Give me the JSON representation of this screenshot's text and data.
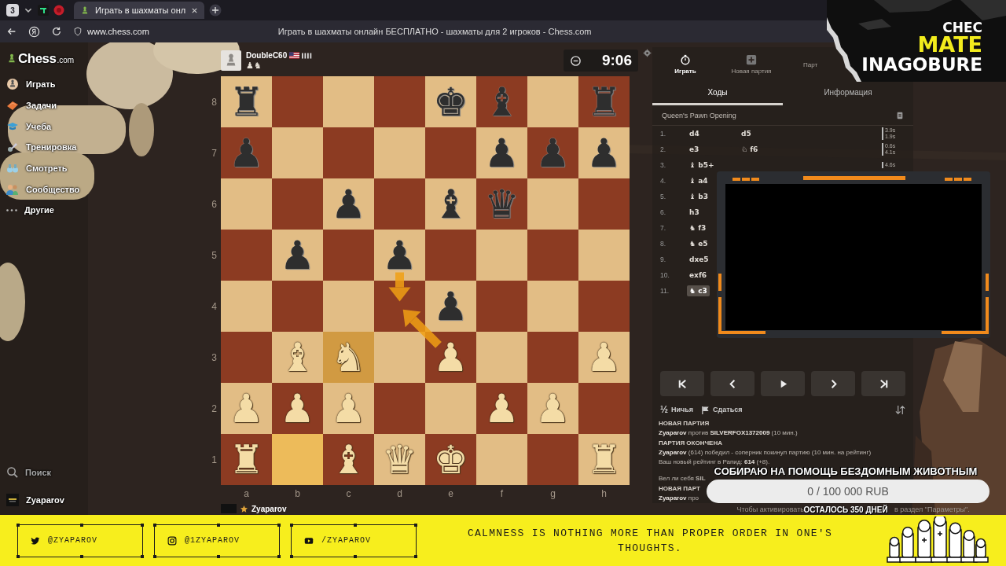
{
  "browser": {
    "tab_count": "3",
    "tabs": [
      {
        "title": "Играть в шахматы онл",
        "selected": true
      }
    ],
    "address": "www.chess.com",
    "page_title": "Играть в шахматы онлайн БЕСПЛАТНО - шахматы для 2 игроков - Chess.com"
  },
  "sidebar": {
    "logo": {
      "name": "Chess",
      "suffix": ".com"
    },
    "items": [
      {
        "kind": "play",
        "label": "Играть"
      },
      {
        "kind": "puzzles",
        "label": "Задачи"
      },
      {
        "kind": "learn",
        "label": "Учеба"
      },
      {
        "kind": "train",
        "label": "Тренировка"
      },
      {
        "kind": "watch",
        "label": "Смотреть"
      },
      {
        "kind": "community",
        "label": "Сообщество"
      },
      {
        "kind": "more",
        "label": "Другие"
      }
    ],
    "search": "Поиск",
    "user": "Zyaparov"
  },
  "board": {
    "top_player": {
      "name": "DoubleC60",
      "captured": "♟♞"
    },
    "clock": "9:06",
    "rank_labels": [
      "8",
      "7",
      "6",
      "5",
      "4",
      "3",
      "2",
      "1"
    ],
    "file_labels": [
      "a",
      "b",
      "c",
      "d",
      "e",
      "f",
      "g",
      "h"
    ],
    "ranks": [
      {
        "squares": [
          {
            "piece": "♜",
            "kind": "black",
            "highlighted": false,
            "arrow_start": false,
            "arrow_end": false
          },
          {
            "highlighted": false,
            "arrow_start": false,
            "arrow_end": false
          },
          {
            "highlighted": false,
            "arrow_start": false,
            "arrow_end": false
          },
          {
            "highlighted": false,
            "arrow_start": false,
            "arrow_end": false
          },
          {
            "piece": "♚",
            "kind": "black",
            "highlighted": false,
            "arrow_start": false,
            "arrow_end": false
          },
          {
            "piece": "♝",
            "kind": "black",
            "highlighted": false,
            "arrow_start": false,
            "arrow_end": false
          },
          {
            "highlighted": false,
            "arrow_start": false,
            "arrow_end": false
          },
          {
            "piece": "♜",
            "kind": "black",
            "highlighted": false,
            "arrow_start": false,
            "arrow_end": false
          }
        ]
      },
      {
        "squares": [
          {
            "piece": "♟",
            "kind": "black",
            "highlighted": false,
            "arrow_start": false,
            "arrow_end": false
          },
          {
            "highlighted": false,
            "arrow_start": false,
            "arrow_end": false
          },
          {
            "highlighted": false,
            "arrow_start": false,
            "arrow_end": false
          },
          {
            "highlighted": false,
            "arrow_start": false,
            "arrow_end": false
          },
          {
            "highlighted": false,
            "arrow_start": false,
            "arrow_end": false
          },
          {
            "piece": "♟",
            "kind": "black",
            "highlighted": false,
            "arrow_start": false,
            "arrow_end": false
          },
          {
            "piece": "♟",
            "kind": "black",
            "highlighted": false,
            "arrow_start": false,
            "arrow_end": false
          },
          {
            "piece": "♟",
            "kind": "black",
            "highlighted": false,
            "arrow_start": false,
            "arrow_end": false
          }
        ]
      },
      {
        "squares": [
          {
            "highlighted": false,
            "arrow_start": false,
            "arrow_end": false
          },
          {
            "highlighted": false,
            "arrow_start": false,
            "arrow_end": false
          },
          {
            "piece": "♟",
            "kind": "black",
            "highlighted": false,
            "arrow_start": false,
            "arrow_end": false
          },
          {
            "highlighted": false,
            "arrow_start": false,
            "arrow_end": false
          },
          {
            "piece": "♝",
            "kind": "black",
            "highlighted": false,
            "arrow_start": false,
            "arrow_end": false
          },
          {
            "piece": "♛",
            "kind": "black",
            "highlighted": false,
            "arrow_start": false,
            "arrow_end": false
          },
          {
            "highlighted": false,
            "arrow_start": false,
            "arrow_end": false
          },
          {
            "highlighted": false,
            "arrow_start": false,
            "arrow_end": false
          }
        ]
      },
      {
        "squares": [
          {
            "highlighted": false,
            "arrow_start": false,
            "arrow_end": false
          },
          {
            "piece": "♟",
            "kind": "black",
            "highlighted": false,
            "arrow_start": false,
            "arrow_end": false
          },
          {
            "highlighted": false,
            "arrow_start": false,
            "arrow_end": false
          },
          {
            "piece": "♟",
            "kind": "black",
            "highlighted": false,
            "arrow_start": true,
            "arrow_end": false
          },
          {
            "highlighted": false,
            "arrow_start": false,
            "arrow_end": false
          },
          {
            "highlighted": false,
            "arrow_start": false,
            "arrow_end": false
          },
          {
            "highlighted": false,
            "arrow_start": false,
            "arrow_end": false
          },
          {
            "highlighted": false,
            "arrow_start": false,
            "arrow_end": false
          }
        ]
      },
      {
        "squares": [
          {
            "highlighted": false,
            "arrow_start": false,
            "arrow_end": false
          },
          {
            "highlighted": false,
            "arrow_start": false,
            "arrow_end": false
          },
          {
            "highlighted": false,
            "arrow_start": false,
            "arrow_end": false
          },
          {
            "highlighted": false,
            "arrow_start": false,
            "arrow_end": true
          },
          {
            "piece": "♟",
            "kind": "black",
            "highlighted": false,
            "arrow_start": false,
            "arrow_end": false
          },
          {
            "highlighted": false,
            "arrow_start": false,
            "arrow_end": false
          },
          {
            "highlighted": false,
            "arrow_start": false,
            "arrow_end": false
          },
          {
            "highlighted": false,
            "arrow_start": false,
            "arrow_end": false
          }
        ]
      },
      {
        "squares": [
          {
            "highlighted": false,
            "arrow_start": false,
            "arrow_end": false
          },
          {
            "piece": "♝",
            "kind": "white",
            "highlighted": false,
            "arrow_start": false,
            "arrow_end": false
          },
          {
            "piece": "♞",
            "kind": "white",
            "highlighted": true,
            "arrow_start": false,
            "arrow_end": false
          },
          {
            "highlighted": false,
            "arrow_start": false,
            "arrow_end": false
          },
          {
            "piece": "♟",
            "kind": "white",
            "highlighted": false,
            "arrow_start": true,
            "arrow_end": false
          },
          {
            "highlighted": false,
            "arrow_start": false,
            "arrow_end": false
          },
          {
            "highlighted": false,
            "arrow_start": false,
            "arrow_end": false
          },
          {
            "piece": "♟",
            "kind": "white",
            "highlighted": false,
            "arrow_start": false,
            "arrow_end": false
          }
        ]
      },
      {
        "squares": [
          {
            "piece": "♟",
            "kind": "white",
            "highlighted": false,
            "arrow_start": false,
            "arrow_end": false
          },
          {
            "piece": "♟",
            "kind": "white",
            "highlighted": false,
            "arrow_start": false,
            "arrow_end": false
          },
          {
            "piece": "♟",
            "kind": "white",
            "highlighted": false,
            "arrow_start": false,
            "arrow_end": false
          },
          {
            "highlighted": false,
            "arrow_start": false,
            "arrow_end": false
          },
          {
            "highlighted": false,
            "arrow_start": false,
            "arrow_end": false
          },
          {
            "piece": "♟",
            "kind": "white",
            "highlighted": false,
            "arrow_start": false,
            "arrow_end": false
          },
          {
            "piece": "♟",
            "kind": "white",
            "highlighted": false,
            "arrow_start": false,
            "arrow_end": false
          },
          {
            "highlighted": false,
            "arrow_start": false,
            "arrow_end": false
          }
        ]
      },
      {
        "squares": [
          {
            "piece": "♜",
            "kind": "white",
            "highlighted": false,
            "arrow_start": false,
            "arrow_end": false
          },
          {
            "highlighted": true,
            "arrow_start": false,
            "arrow_end": false
          },
          {
            "piece": "♝",
            "kind": "white",
            "highlighted": false,
            "arrow_start": false,
            "arrow_end": false
          },
          {
            "piece": "♛",
            "kind": "white",
            "highlighted": false,
            "arrow_start": false,
            "arrow_end": false
          },
          {
            "piece": "♚",
            "kind": "white",
            "highlighted": false,
            "arrow_start": false,
            "arrow_end": false
          },
          {
            "highlighted": false,
            "arrow_start": false,
            "arrow_end": false
          },
          {
            "highlighted": false,
            "arrow_start": false,
            "arrow_end": false
          },
          {
            "piece": "♜",
            "kind": "white",
            "highlighted": false,
            "arrow_start": false,
            "arrow_end": false
          }
        ]
      }
    ],
    "bottom_player": {
      "name": "Zyaparov"
    }
  },
  "panel": {
    "top_tabs": [
      {
        "kind": "play",
        "label": "Играть",
        "selected": true
      },
      {
        "kind": "new",
        "label": "Новая партия",
        "selected": false
      },
      {
        "kind": "games",
        "label": "Парт",
        "selected": false
      }
    ],
    "tabs": [
      {
        "label": "Ходы",
        "selected": true
      },
      {
        "label": "Информация",
        "selected": false
      }
    ],
    "opening": "Queen's Pawn Opening",
    "moves": [
      {
        "number": "1.",
        "white": {
          "text": "d4",
          "selected": false
        },
        "black": {
          "text": "d5",
          "selected": false
        },
        "times": [
          "3.9s",
          "1.9s"
        ]
      },
      {
        "number": "2.",
        "white": {
          "text": "e3",
          "selected": false
        },
        "black": {
          "text": "♘ f6",
          "selected": false
        },
        "times": [
          "0.6s",
          "4.1s"
        ]
      },
      {
        "number": "3.",
        "white": {
          "text": "♝ b5+",
          "selected": false
        },
        "times": [
          "4.6s"
        ]
      },
      {
        "number": "4.",
        "white": {
          "text": "♝ a4",
          "selected": false
        }
      },
      {
        "number": "5.",
        "white": {
          "text": "♝ b3",
          "selected": false
        }
      },
      {
        "number": "6.",
        "white": {
          "text": "h3",
          "selected": false
        }
      },
      {
        "number": "7.",
        "white": {
          "text": "♞ f3",
          "selected": false
        }
      },
      {
        "number": "8.",
        "white": {
          "text": "♞ e5",
          "selected": false
        }
      },
      {
        "number": "9.",
        "white": {
          "text": "dxe5",
          "selected": false
        }
      },
      {
        "number": "10.",
        "white": {
          "text": "exf6",
          "selected": false
        }
      },
      {
        "number": "11.",
        "white": {
          "text": "♞ c3",
          "selected": true
        }
      }
    ],
    "actions": [
      {
        "kind": "draw",
        "symbol": "½",
        "label": "Ничья"
      },
      {
        "kind": "resign",
        "label": "Сдаться"
      }
    ],
    "chat": [
      {
        "kind": "heading",
        "text": "НОВАЯ ПАРТИЯ"
      },
      {
        "kind": "line",
        "text": "**Zyaparov** против **SILVERFOX1372009** (10 мин.)"
      },
      {
        "kind": "heading",
        "text": "ПАРТИЯ ОКОНЧЕНА"
      },
      {
        "kind": "line",
        "text": "**Zyaparov** (614) победил - соперник покинул партию (10 мин. на рейтинг)"
      },
      {
        "kind": "line",
        "text": "Ваш новый рейтинг в Рапид: **614** (+8)."
      },
      {
        "kind": "question",
        "text": "Вел ли себя **SIL**"
      },
      {
        "kind": "heading",
        "text": "НОВАЯ ПАРТ"
      },
      {
        "kind": "line",
        "text": "**Zyaparov** про"
      }
    ],
    "hint": [
      "Чтобы активировать",
      "в раздел \"Параметры\"."
    ]
  },
  "overlay": {
    "brand": [
      {
        "text": "CHEC",
        "accent": false
      },
      {
        "text": "MATE",
        "accent": true
      },
      {
        "text": "INAGOBURE",
        "accent": false
      }
    ],
    "donation": {
      "title": "СОБИРАЮ НА ПОМОЩЬ БЕЗДОМНЫМ ЖИВОТНЫМ",
      "amount": "0 / 100 000 RUB",
      "level": 0,
      "remaining": "ОСТАЛОСЬ 350 ДНЕЙ"
    }
  },
  "footer": {
    "socials": [
      {
        "kind": "twitter",
        "handle": "@ZYAPAROV"
      },
      {
        "kind": "instagram",
        "handle": "@1ZYAPAROV"
      },
      {
        "kind": "youtube",
        "handle": "/ZYAPAROV"
      }
    ],
    "quote": "CALMNESS IS NOTHING MORE THAN PROPER ORDER IN ONE'S THOUGHTS."
  }
}
